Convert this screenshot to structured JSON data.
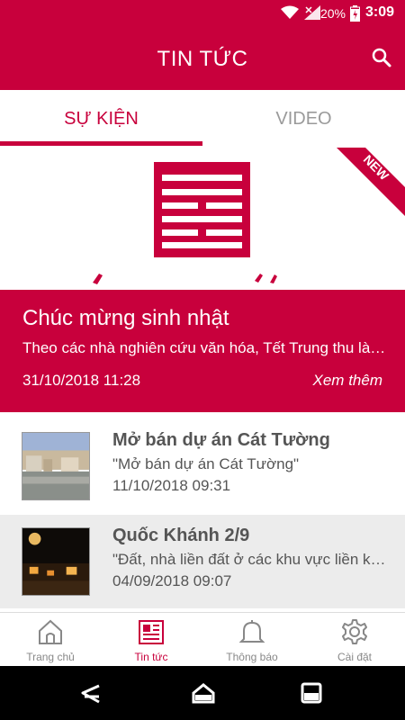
{
  "status_bar": {
    "battery": "20%",
    "time": "3:09"
  },
  "app_bar": {
    "title": "TIN TỨC",
    "search_icon": "search-icon"
  },
  "tabs": [
    {
      "label": "SỰ KIỆN",
      "active": true
    },
    {
      "label": "VIDEO",
      "active": false
    }
  ],
  "featured": {
    "badge": "NEW",
    "title": "Chúc mừng sinh nhật",
    "description": "Theo các nhà nghiên cứu văn hóa, Tết Trung thu là…",
    "date": "31/10/2018 11:28",
    "more_label": "Xem thêm"
  },
  "news_list": [
    {
      "title": "Mở bán dự án Cát Tường",
      "description": "\"Mở bán dự án Cát Tường\"",
      "date": "11/10/2018 09:31"
    },
    {
      "title": "Quốc Khánh 2/9",
      "description": "\"Đất, nhà liền đất ở các khu vực liền kề…",
      "date": "04/09/2018 09:07"
    }
  ],
  "bottom_nav": [
    {
      "label": "Trang chủ",
      "icon": "home-icon"
    },
    {
      "label": "Tin tức",
      "icon": "news-icon",
      "active": true
    },
    {
      "label": "Thông báo",
      "icon": "bell-icon"
    },
    {
      "label": "Cài đặt",
      "icon": "gear-icon"
    }
  ],
  "colors": {
    "brand": "#c8003c",
    "text_gray": "#555555",
    "inactive_gray": "#9a9a9a"
  }
}
